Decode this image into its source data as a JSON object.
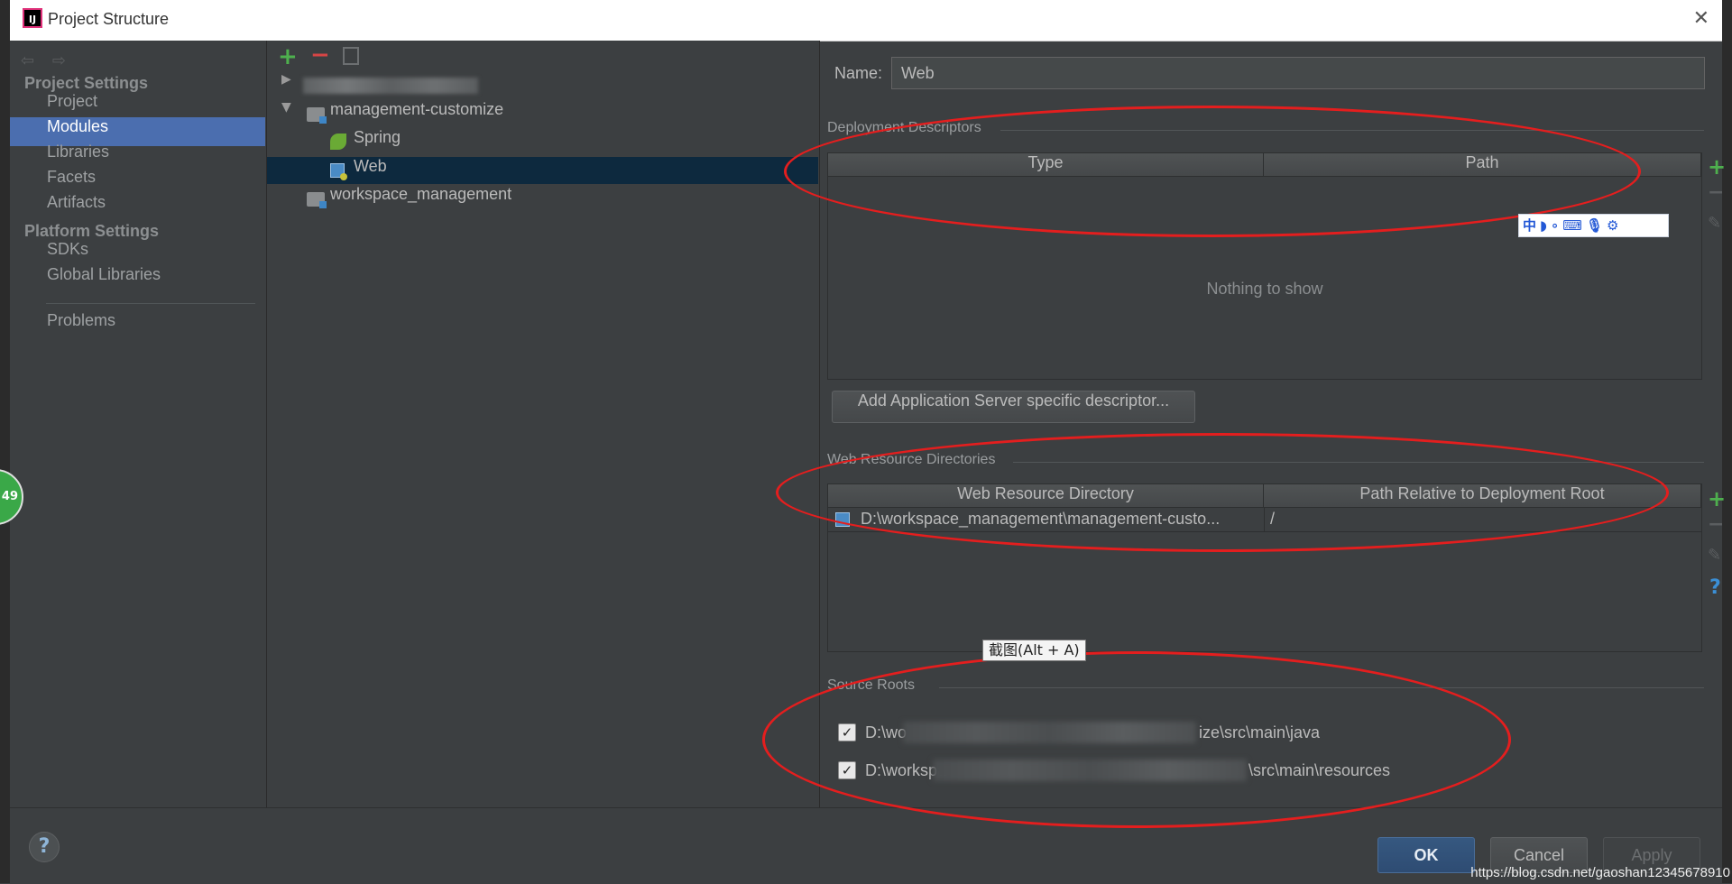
{
  "window": {
    "title": "Project Structure",
    "logo_text": "IJ",
    "close_glyph": "✕"
  },
  "nav": {
    "back_glyph": "⇦",
    "forward_glyph": "⇨",
    "project_settings_heading": "Project Settings",
    "platform_settings_heading": "Platform Settings",
    "items": [
      {
        "label": "Project"
      },
      {
        "label": "Modules"
      },
      {
        "label": "Libraries"
      },
      {
        "label": "Facets"
      },
      {
        "label": "Artifacts"
      },
      {
        "label": "SDKs"
      },
      {
        "label": "Global Libraries"
      },
      {
        "label": "Problems"
      }
    ],
    "selected": "Modules"
  },
  "tree": {
    "toolbar": {
      "add_glyph": "+",
      "remove_glyph": "−"
    },
    "rows": [
      {
        "label": ""
      },
      {
        "label": "management-customize"
      },
      {
        "label": "Spring"
      },
      {
        "label": "Web"
      },
      {
        "label": "workspace_management"
      }
    ],
    "selected": "Web"
  },
  "detail": {
    "name_label": "Name:",
    "name_value": "Web",
    "deployment": {
      "title": "Deployment Descriptors",
      "columns": [
        "Type",
        "Path"
      ],
      "empty_text": "Nothing to show",
      "add_button": "Add Application Server specific descriptor..."
    },
    "web_resources": {
      "title": "Web Resource Directories",
      "columns": [
        "Web Resource Directory",
        "Path Relative to Deployment Root"
      ],
      "rows": [
        {
          "directory": "D:\\workspace_management\\management-custo...",
          "path": "/"
        }
      ]
    },
    "source_roots": {
      "title": "Source Roots",
      "items": [
        {
          "prefix": "D:\\wo",
          "suffix": "ize\\src\\main\\java",
          "checked": true
        },
        {
          "prefix": "D:\\workspa",
          "suffix": "\\src\\main\\resources",
          "checked": true
        }
      ]
    },
    "side_tools": {
      "add": "+",
      "remove": "−",
      "edit": "✎",
      "help": "?"
    }
  },
  "overlays": {
    "tooltip": "截图(Alt + A)",
    "ime_toolbar": "中◗∘⌨🎙⚙",
    "side_badge": "49",
    "annotation_color": "#e41e1e"
  },
  "footer": {
    "help": "?",
    "ok": "OK",
    "cancel": "Cancel",
    "apply": "Apply",
    "watermark": "https://blog.csdn.net/gaoshan12345678910"
  }
}
